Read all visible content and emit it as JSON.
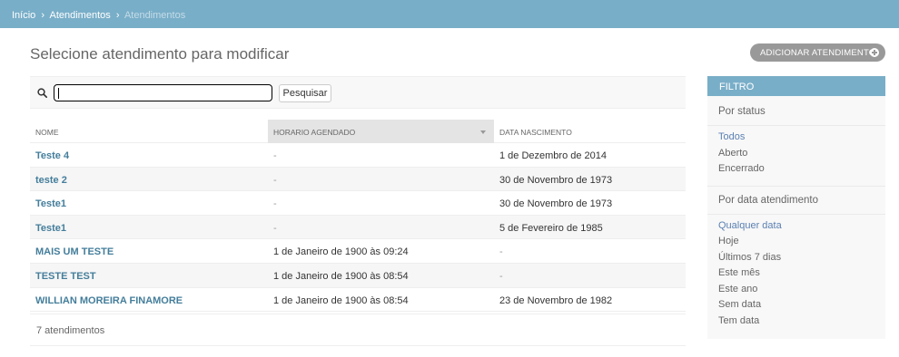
{
  "breadcrumbs": {
    "home": "Início",
    "separator": "›",
    "section": "Atendimentos",
    "current": "Atendimentos"
  },
  "page": {
    "title": "Selecione atendimento para modificar",
    "add_button": "Adicionar atendimento"
  },
  "search": {
    "value": "",
    "button": "Pesquisar"
  },
  "table": {
    "columns": [
      "Nome",
      "Horario agendado",
      "Data nascimento"
    ],
    "rows": [
      {
        "nome": "Teste 4",
        "horario": "-",
        "nascimento": "1 de Dezembro de 2014"
      },
      {
        "nome": "teste 2",
        "horario": "-",
        "nascimento": "30 de Novembro de 1973"
      },
      {
        "nome": "Teste1",
        "horario": "-",
        "nascimento": "30 de Novembro de 1973"
      },
      {
        "nome": "Teste1",
        "horario": "-",
        "nascimento": "5 de Fevereiro de 1985"
      },
      {
        "nome": "MAIS UM TESTE",
        "horario": "1 de Janeiro de 1900 às 09:24",
        "nascimento": "-"
      },
      {
        "nome": "TESTE TEST",
        "horario": "1 de Janeiro de 1900 às 08:54",
        "nascimento": "-"
      },
      {
        "nome": "WILLIAN MOREIRA FINAMORE",
        "horario": "1 de Janeiro de 1900 às 08:54",
        "nascimento": "23 de Novembro de 1982"
      }
    ],
    "count": "7 atendimentos"
  },
  "filter": {
    "header": "Filtro",
    "status": {
      "title": "Por status",
      "options": [
        "Todos",
        "Aberto",
        "Encerrado"
      ],
      "selected": "Todos"
    },
    "data": {
      "title": "Por data atendimento",
      "options": [
        "Qualquer data",
        "Hoje",
        "Últimos 7 dias",
        "Este mês",
        "Este ano",
        "Sem data",
        "Tem data"
      ],
      "selected": "Qualquer data"
    }
  },
  "colors": {
    "header_bar": "#79aec8",
    "link": "#447e9b",
    "selected_filter": "#5b80b2",
    "add_button": "#999999"
  },
  "icons": {
    "search": "search-icon",
    "add": "plus-icon",
    "sort": "sort-desc-icon"
  }
}
